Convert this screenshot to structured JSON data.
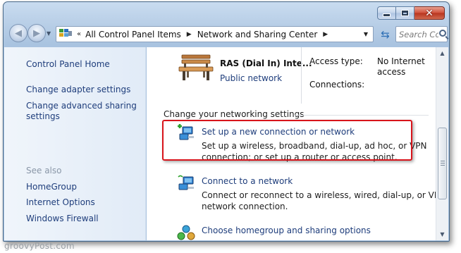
{
  "window": {
    "caption_buttons": {
      "minimize": "minimize-icon",
      "maximize": "maximize-icon",
      "close": "✕"
    }
  },
  "nav": {
    "back_icon": "back-arrow-icon",
    "forward_icon": "forward-arrow-icon",
    "address_prefix": "«",
    "breadcrumb": [
      "All Control Panel Items",
      "Network and Sharing Center"
    ],
    "search_placeholder": "Search Con..."
  },
  "sidebar": {
    "home": "Control Panel Home",
    "links": [
      "Change adapter settings",
      "Change advanced sharing settings"
    ],
    "see_also_title": "See also",
    "see_also": [
      "HomeGroup",
      "Internet Options",
      "Windows Firewall"
    ]
  },
  "network": {
    "name": "RAS (Dial In) Inte...",
    "type": "Public network",
    "access_type_label": "Access type:",
    "access_type_value": "No Internet access",
    "connections_label": "Connections:",
    "connections_value": ""
  },
  "settings": {
    "title": "Change your networking settings",
    "tasks": [
      {
        "link": "Set up a new connection or network",
        "desc_line1": "Set up a wireless, broadband, dial-up, ad hoc, or VPN",
        "desc_line2": "connection; or set up a router or access point."
      },
      {
        "link": "Connect to a network",
        "desc_line1": "Connect or reconnect to a wireless, wired, dial-up, or VPN",
        "desc_line2": "network connection."
      },
      {
        "link": "Choose homegroup and sharing options",
        "desc_line1": "",
        "desc_line2": ""
      }
    ]
  },
  "colors": {
    "link": "#1e3d7b",
    "highlight_border": "#d8141b",
    "close_button": "#c7422c"
  },
  "watermark": "groovyPost.com"
}
